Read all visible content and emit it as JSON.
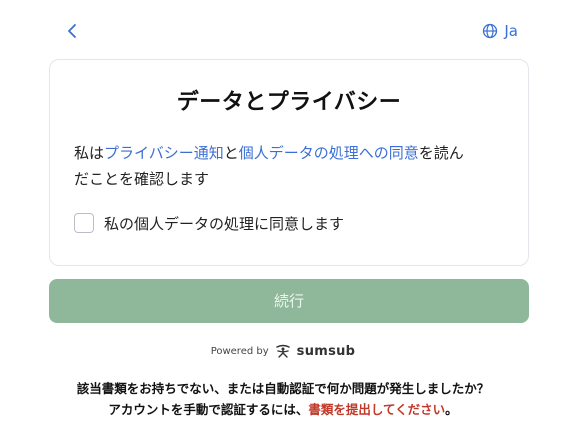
{
  "header": {
    "back_icon": "chevron-left-icon",
    "language_icon": "globe-icon",
    "language_label": "Ja"
  },
  "card": {
    "title": "データとプライバシー",
    "consent": {
      "prefix": "私は",
      "privacy_link": "プライバシー通知",
      "middle": "と",
      "consent_link": "個人データの処理への同意",
      "suffix_line1": "を読ん",
      "suffix_line2": "だことを確認します"
    },
    "checkbox_label": "私の個人データの処理に同意します",
    "checkbox_checked": false
  },
  "continue_label": "続行",
  "powered": {
    "text": "Powered by",
    "brand": "sumsub",
    "brand_icon": "sumsub-logo-icon"
  },
  "footer": {
    "line1": "該当書類をお持ちでない、または自動認証で何か問題が発生しましたか？",
    "line2_prefix": "アカウントを手動で認証するには、",
    "line2_link": "書類を提出してください",
    "line2_suffix": "。"
  },
  "colors": {
    "link": "#3b6fd4",
    "button_disabled": "#8fb89a",
    "footer_link": "#c0392b"
  }
}
